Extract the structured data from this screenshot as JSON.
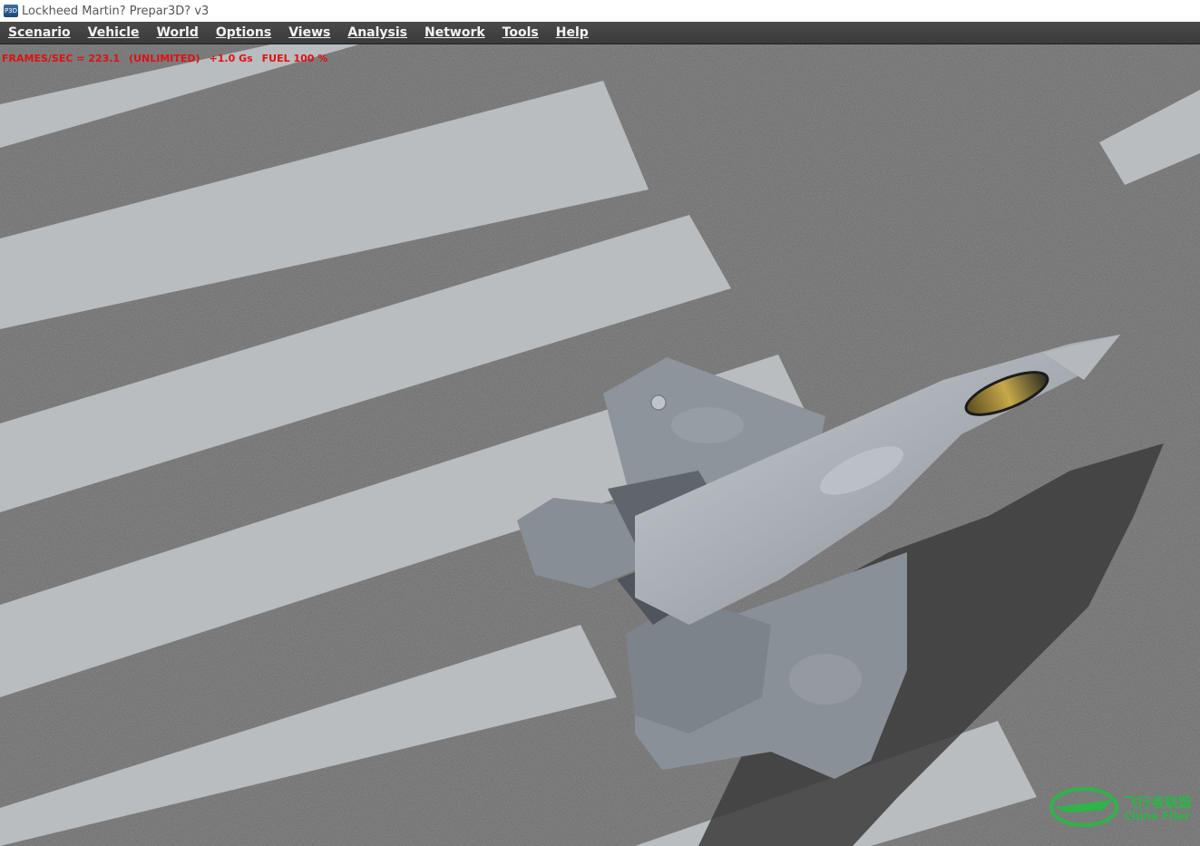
{
  "window": {
    "title": "Lockheed Martin? Prepar3D? v3",
    "icon": "p3d-app-icon"
  },
  "menu": {
    "items": [
      {
        "label": "Scenario"
      },
      {
        "label": "Vehicle"
      },
      {
        "label": "World"
      },
      {
        "label": "Options"
      },
      {
        "label": "Views"
      },
      {
        "label": "Analysis"
      },
      {
        "label": "Network"
      },
      {
        "label": "Tools"
      },
      {
        "label": "Help"
      }
    ]
  },
  "hud": {
    "frames": "FRAMES/SEC = 223.1",
    "mode": "(UNLIMITED)",
    "gforce": "+1.0 Gs",
    "fuel": "FUEL 100 %"
  },
  "watermark": {
    "chinese": "飞行者联盟",
    "english": "China Flier"
  },
  "colors": {
    "hud_text": "#e01010",
    "menubar_bg": "#414141",
    "menu_text": "#f4f4f4",
    "ground": "#6d6d6d",
    "stripe": "#b9bdbf",
    "watermark": "#2fb34a"
  }
}
